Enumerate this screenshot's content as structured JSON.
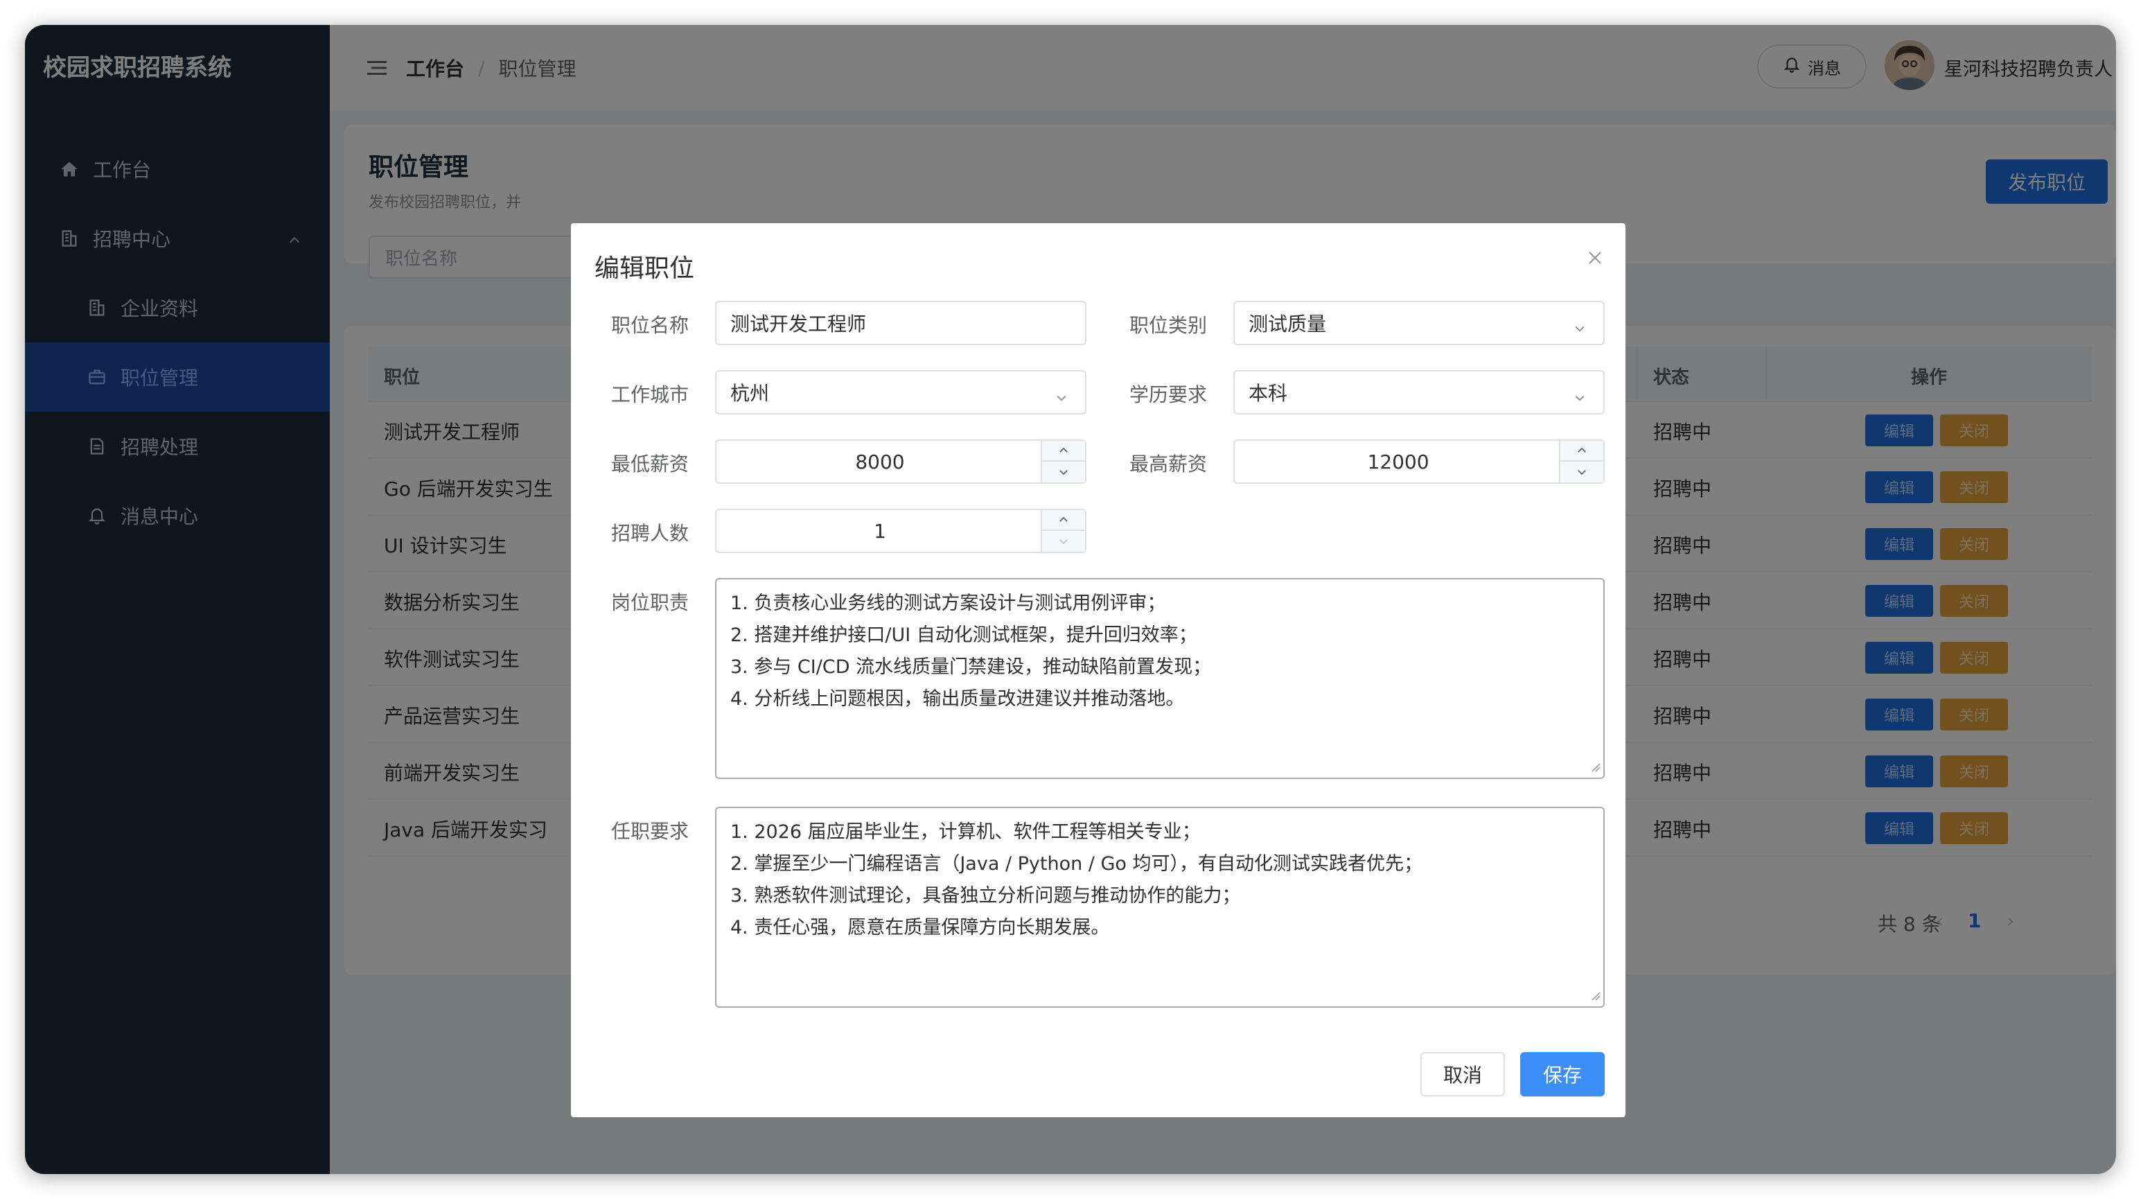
{
  "app": {
    "title": "校园求职招聘系统"
  },
  "sidebar": {
    "items": [
      {
        "label": "工作台",
        "icon": "home-icon"
      },
      {
        "label": "招聘中心",
        "icon": "building-icon",
        "expanded": true
      },
      {
        "label": "企业资料",
        "icon": "building-icon"
      },
      {
        "label": "职位管理",
        "icon": "briefcase-icon",
        "active": true
      },
      {
        "label": "招聘处理",
        "icon": "document-icon"
      },
      {
        "label": "消息中心",
        "icon": "bell-icon"
      }
    ]
  },
  "header": {
    "breadcrumb": [
      "工作台",
      "职位管理"
    ],
    "message_label": "消息",
    "user_name": "星河科技招聘负责人"
  },
  "page": {
    "title": "职位管理",
    "subtitle": "发布校园招聘职位，并",
    "publish_label": "发布职位",
    "search_placeholder": "职位名称"
  },
  "table": {
    "headers": {
      "position": "职位",
      "status": "状态",
      "actions": "操作"
    },
    "edit_label": "编辑",
    "close_label": "关闭",
    "rows": [
      {
        "name": "测试开发工程师",
        "status": "招聘中"
      },
      {
        "name": "Go 后端开发实习生",
        "status": "招聘中"
      },
      {
        "name": "UI 设计实习生",
        "status": "招聘中"
      },
      {
        "name": "数据分析实习生",
        "status": "招聘中"
      },
      {
        "name": "软件测试实习生",
        "status": "招聘中"
      },
      {
        "name": "产品运营实习生",
        "status": "招聘中"
      },
      {
        "name": "前端开发实习生",
        "status": "招聘中"
      },
      {
        "name": "Java 后端开发实习",
        "status": "招聘中"
      }
    ],
    "pager": {
      "total": "共 8 条",
      "prev": "‹",
      "page": "1",
      "next": "›"
    }
  },
  "dialog": {
    "title": "编辑职位",
    "fields": {
      "name_label": "职位名称",
      "name_value": "测试开发工程师",
      "category_label": "职位类别",
      "category_value": "测试质量",
      "city_label": "工作城市",
      "city_value": "杭州",
      "education_label": "学历要求",
      "education_value": "本科",
      "min_salary_label": "最低薪资",
      "min_salary_value": "8000",
      "max_salary_label": "最高薪资",
      "max_salary_value": "12000",
      "headcount_label": "招聘人数",
      "headcount_value": "1",
      "duties_label": "岗位职责",
      "duties": [
        "1. 负责核心业务线的测试方案设计与测试用例评审；",
        "2. 搭建并维护接口/UI 自动化测试框架，提升回归效率；",
        "3. 参与 CI/CD 流水线质量门禁建设，推动缺陷前置发现；",
        "4. 分析线上问题根因，输出质量改进建议并推动落地。"
      ],
      "requirements_label": "任职要求",
      "requirements": [
        "1. 2026 届应届毕业生，计算机、软件工程等相关专业；",
        "2. 掌握至少一门编程语言（Java / Python / Go 均可），有自动化测试实践者优先；",
        "3. 熟悉软件测试理论，具备独立分析问题与推动协作的能力；",
        "4. 责任心强，愿意在质量保障方向长期发展。"
      ]
    },
    "cancel_label": "取消",
    "save_label": "保存"
  },
  "colors": {
    "sidebar_bg": "#1f2d3d",
    "primary": "#1f6fe0",
    "warning": "#e6a23c",
    "save": "#3a8ef6"
  }
}
